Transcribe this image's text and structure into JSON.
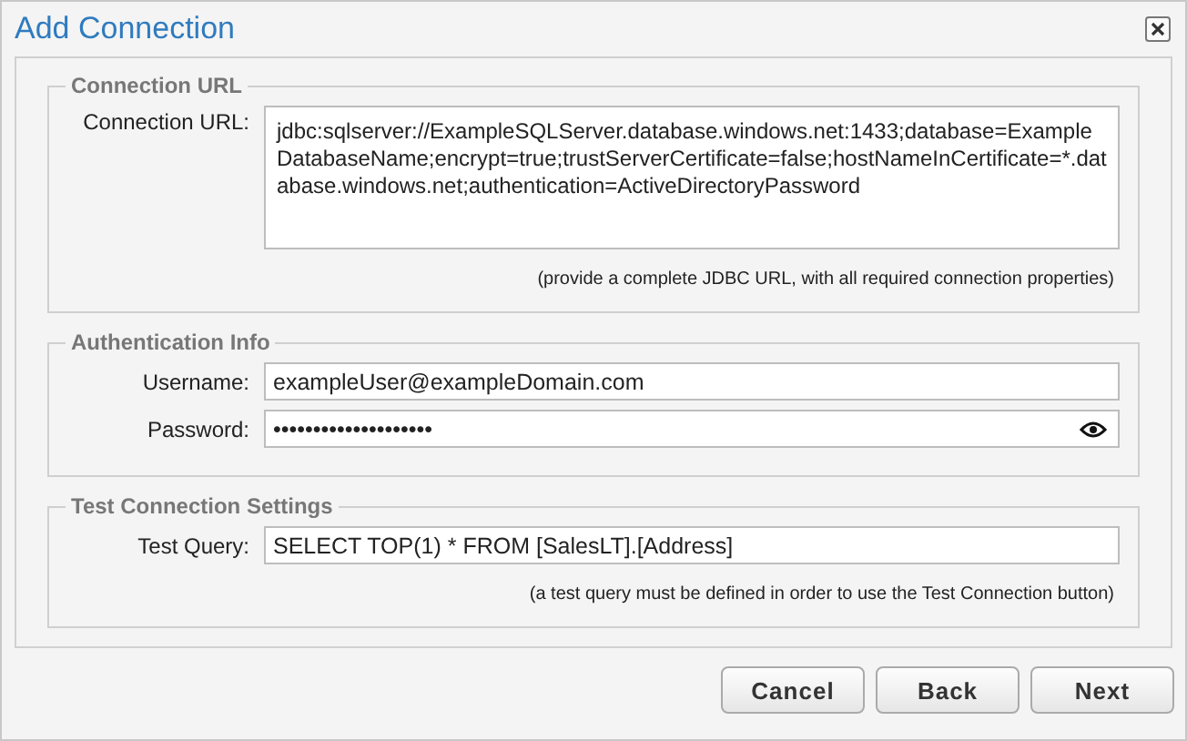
{
  "window": {
    "title": "Add Connection"
  },
  "sections": [
    {
      "legend": "Connection URL",
      "fields": [
        {
          "kind": "multiline",
          "label": "Connection URL:",
          "value": "jdbc:sqlserver://ExampleSQLServer.database.windows.net:1433;database=ExampleDatabaseName;encrypt=true;trustServerCertificate=false;hostNameInCertificate=*.database.windows.net;authentication=ActiveDirectoryPassword"
        }
      ],
      "hint": "(provide a complete JDBC URL, with all required connection properties)"
    },
    {
      "legend": "Authentication Info",
      "fields": [
        {
          "kind": "text",
          "label": "Username:",
          "value": "exampleUser@exampleDomain.com"
        },
        {
          "kind": "password",
          "label": "Password:",
          "value": "••••••••••••••••••••"
        }
      ]
    },
    {
      "legend": "Test Connection Settings",
      "fields": [
        {
          "kind": "text",
          "label": "Test Query:",
          "value": "SELECT TOP(1) * FROM [SalesLT].[Address]"
        }
      ],
      "hint": "(a test query must be defined in order to use the Test Connection button)"
    }
  ],
  "buttons": [
    "Cancel",
    "Back",
    "Next"
  ]
}
